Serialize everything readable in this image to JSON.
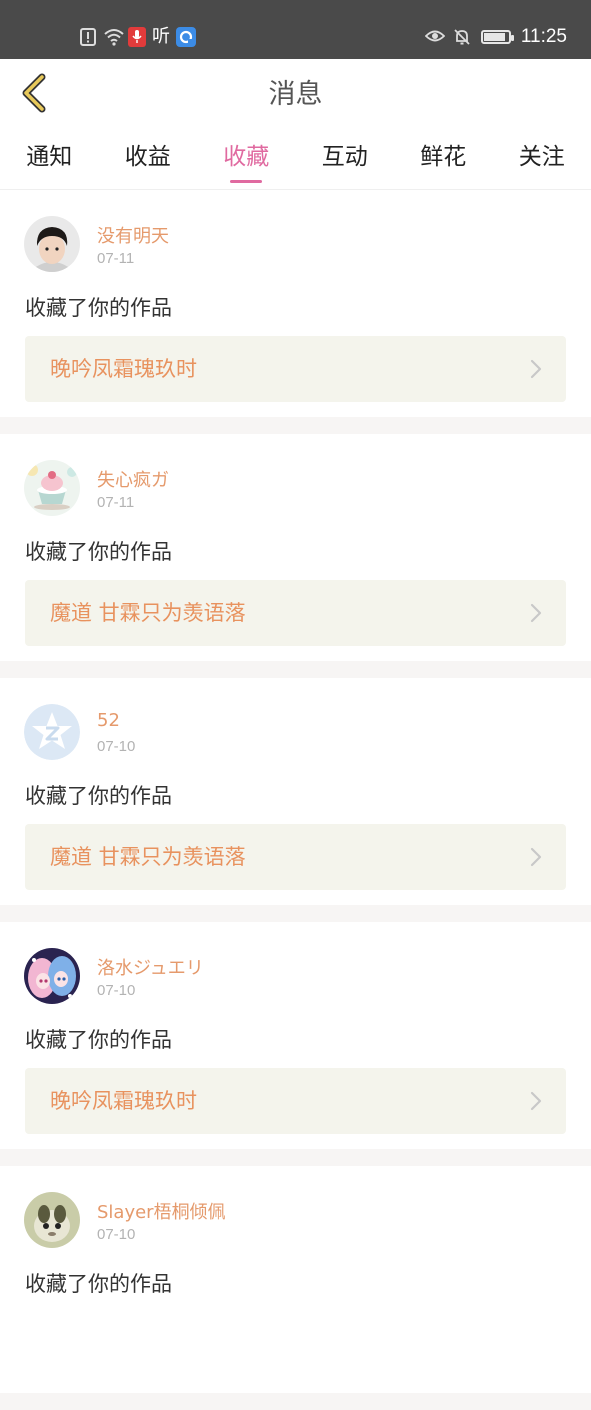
{
  "status_bar": {
    "time": "11:25",
    "listen_label": "听",
    "icons": [
      "alert-file-icon",
      "wifi-icon",
      "mic-icon",
      "listen-icon",
      "app-icon",
      "eye-icon",
      "bell-off-icon",
      "battery-icon"
    ]
  },
  "header": {
    "title": "消息",
    "back_icon": "chevron-left-icon"
  },
  "tabs": [
    {
      "label": "通知",
      "active": false
    },
    {
      "label": "收益",
      "active": false
    },
    {
      "label": "收藏",
      "active": true
    },
    {
      "label": "互动",
      "active": false
    },
    {
      "label": "鲜花",
      "active": false
    },
    {
      "label": "关注",
      "active": false
    }
  ],
  "messages": [
    {
      "user": "没有明天",
      "date": "07-11",
      "action": "收藏了你的作品",
      "work": "晚吟凤霜瑰玖时"
    },
    {
      "user": "失心疯ガ",
      "date": "07-11",
      "action": "收藏了你的作品",
      "work": "魔道 甘霖只为羡语落"
    },
    {
      "user": "52",
      "date": "07-10",
      "action": "收藏了你的作品",
      "work": "魔道 甘霖只为羡语落"
    },
    {
      "user": "洛水ジュエリ",
      "date": "07-10",
      "action": "收藏了你的作品",
      "work": "晚吟凤霜瑰玖时"
    },
    {
      "user": "Slayer梧桐倾佩",
      "date": "07-10",
      "action": "收藏了你的作品",
      "work": ""
    }
  ],
  "colors": {
    "accent": "#e06aa0",
    "username": "#e59a6c",
    "work_title": "#e8925e",
    "work_bg": "#f4f4ec",
    "status_bar": "#4a4a4a",
    "back_arrow": "#d6b44a"
  },
  "battery_level": 0.9
}
